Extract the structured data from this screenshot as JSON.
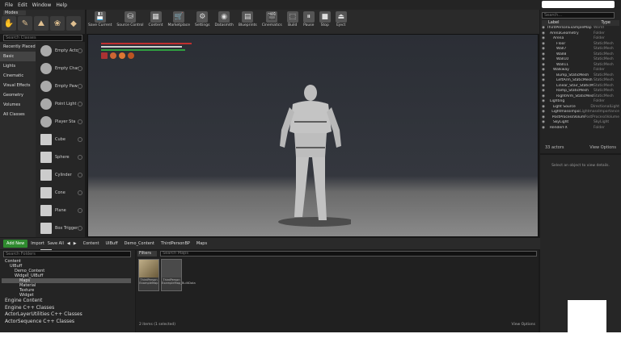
{
  "menu": [
    "File",
    "Edit",
    "Window",
    "Help"
  ],
  "modes_tab": "Modes",
  "mode_icons": [
    "place-icon",
    "paint-icon",
    "landscape-icon",
    "foliage-icon",
    "geometry-icon"
  ],
  "search_classes_placeholder": "Search Classes",
  "categories": [
    "Recently Placed",
    "Basic",
    "Lights",
    "Cinematic",
    "Visual Effects",
    "Geometry",
    "Volumes",
    "All Classes"
  ],
  "place_items": [
    "Empty Acto",
    "Empty Char",
    "Empty Paw",
    "Point Light",
    "Player Sta",
    "Cube",
    "Sphere",
    "Cylinder",
    "Cone",
    "Plane",
    "Box Trigger",
    "Sphere Trig"
  ],
  "toolbar": [
    {
      "label": "Save Current",
      "icon": "save-icon",
      "glyph": "💾"
    },
    {
      "label": "Source Control",
      "icon": "source-control-icon",
      "glyph": "⛁"
    },
    {
      "label": "Content",
      "icon": "content-icon",
      "glyph": "▦"
    },
    {
      "label": "Marketplace",
      "icon": "marketplace-icon",
      "glyph": "🛒"
    },
    {
      "label": "Settings",
      "icon": "settings-icon",
      "glyph": "⚙"
    },
    {
      "label": "Datasmith",
      "icon": "datasmith-icon",
      "glyph": "◉"
    },
    {
      "label": "Blueprints",
      "icon": "blueprints-icon",
      "glyph": "▤"
    },
    {
      "label": "Cinematics",
      "icon": "cinematics-icon",
      "glyph": "🎬"
    },
    {
      "label": "Build",
      "icon": "build-icon",
      "glyph": "⬚"
    },
    {
      "label": "Pause",
      "icon": "pause-icon",
      "glyph": "⏸"
    },
    {
      "label": "Stop",
      "icon": "stop-icon",
      "glyph": "■"
    },
    {
      "label": "Eject",
      "icon": "eject-icon",
      "glyph": "⏏"
    }
  ],
  "outliner": {
    "search_placeholder": "Search...",
    "col_label": "Label",
    "col_type": "Type",
    "rows": [
      {
        "label": "ThirdPersonExampleMap",
        "type": "World"
      },
      {
        "label": "ArenaGeometry",
        "type": "Folder"
      },
      {
        "label": "Arena",
        "type": "Folder"
      },
      {
        "label": "Floor",
        "type": "StaticMesh"
      },
      {
        "label": "Wall7",
        "type": "StaticMesh"
      },
      {
        "label": "Wall8",
        "type": "StaticMesh"
      },
      {
        "label": "Wall10",
        "type": "StaticMesh"
      },
      {
        "label": "Wall11",
        "type": "StaticMesh"
      },
      {
        "label": "Walkway",
        "type": "Folder"
      },
      {
        "label": "Bump_StaticMesh",
        "type": "StaticMesh"
      },
      {
        "label": "LeftArm_StaticMesh",
        "type": "StaticMesh"
      },
      {
        "label": "Linear_Stair_StaticMesh",
        "type": "StaticMesh"
      },
      {
        "label": "Ramp_StaticMesh",
        "type": "StaticMesh"
      },
      {
        "label": "RightArm_StaticMesh",
        "type": "StaticMesh"
      },
      {
        "label": "Lighting",
        "type": "Folder"
      },
      {
        "label": "Light Source",
        "type": "DirectionalLight"
      },
      {
        "label": "Lightmassimportance",
        "type": "LightmassImportance"
      },
      {
        "label": "PostProcessVolume",
        "type": "PostProcessVolume"
      },
      {
        "label": "SkyLight",
        "type": "SkyLight"
      },
      {
        "label": "RenderFX",
        "type": "Folder"
      }
    ],
    "count": "33 actors",
    "view_options": "View Options"
  },
  "details_msg": "Select an object to view details.",
  "content_browser": {
    "add_new": "Add New",
    "import": "Import",
    "save_all": "Save All",
    "breadcrumb": [
      "Content",
      "UIBuff",
      "Demo_Content",
      "ThirdPersonBP",
      "Maps"
    ],
    "search_folders_placeholder": "Search Folders",
    "filters": "Filters",
    "search_assets_placeholder": "Search Maps",
    "tree": [
      {
        "label": "Content",
        "level": 0
      },
      {
        "label": "UIBuff",
        "level": 1
      },
      {
        "label": "Demo_Content",
        "level": 2
      },
      {
        "label": "Widget_UIBuff",
        "level": 2
      },
      {
        "label": "Maps",
        "level": 3,
        "selected": true
      },
      {
        "label": "Material",
        "level": 3
      },
      {
        "label": "Texture",
        "level": 3
      },
      {
        "label": "Widget",
        "level": 3
      }
    ],
    "tree_big": [
      "Engine Content",
      "Engine C++ Classes",
      "ActorLayerUtilities C++ Classes",
      "ActorSequence C++ Classes"
    ],
    "assets": [
      {
        "name": "ThirdPerson ExampleMap"
      },
      {
        "name": "ThirdPerson ExampleMap_BuiltData"
      }
    ],
    "status": "2 items (1 selected)",
    "view_options": "View Options"
  }
}
